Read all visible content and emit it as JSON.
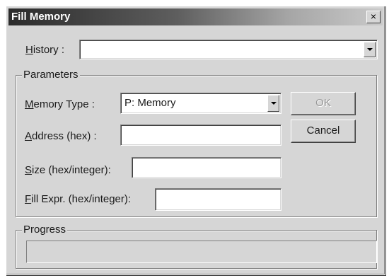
{
  "window": {
    "title": "Fill Memory",
    "close_glyph": "×"
  },
  "history": {
    "label_mnemonic": "H",
    "label_rest": "istory :",
    "value": ""
  },
  "parameters": {
    "group_label": "Parameters",
    "memory_type": {
      "label_mnemonic": "M",
      "label_rest": "emory Type :",
      "selected": "P: Memory"
    },
    "address": {
      "label_mnemonic": "A",
      "label_rest": "ddress (hex) :",
      "value": ""
    },
    "size": {
      "label_mnemonic": "S",
      "label_rest": "ize (hex/integer):",
      "value": ""
    },
    "fill_expr": {
      "label_mnemonic": "F",
      "label_rest": "ill Expr. (hex/integer):",
      "value": ""
    }
  },
  "buttons": {
    "ok_label": "OK",
    "cancel_label": "Cancel"
  },
  "progress": {
    "group_label": "Progress",
    "value": 0
  },
  "icons": {
    "close": "close-icon",
    "dropdown": "chevron-down-icon"
  }
}
